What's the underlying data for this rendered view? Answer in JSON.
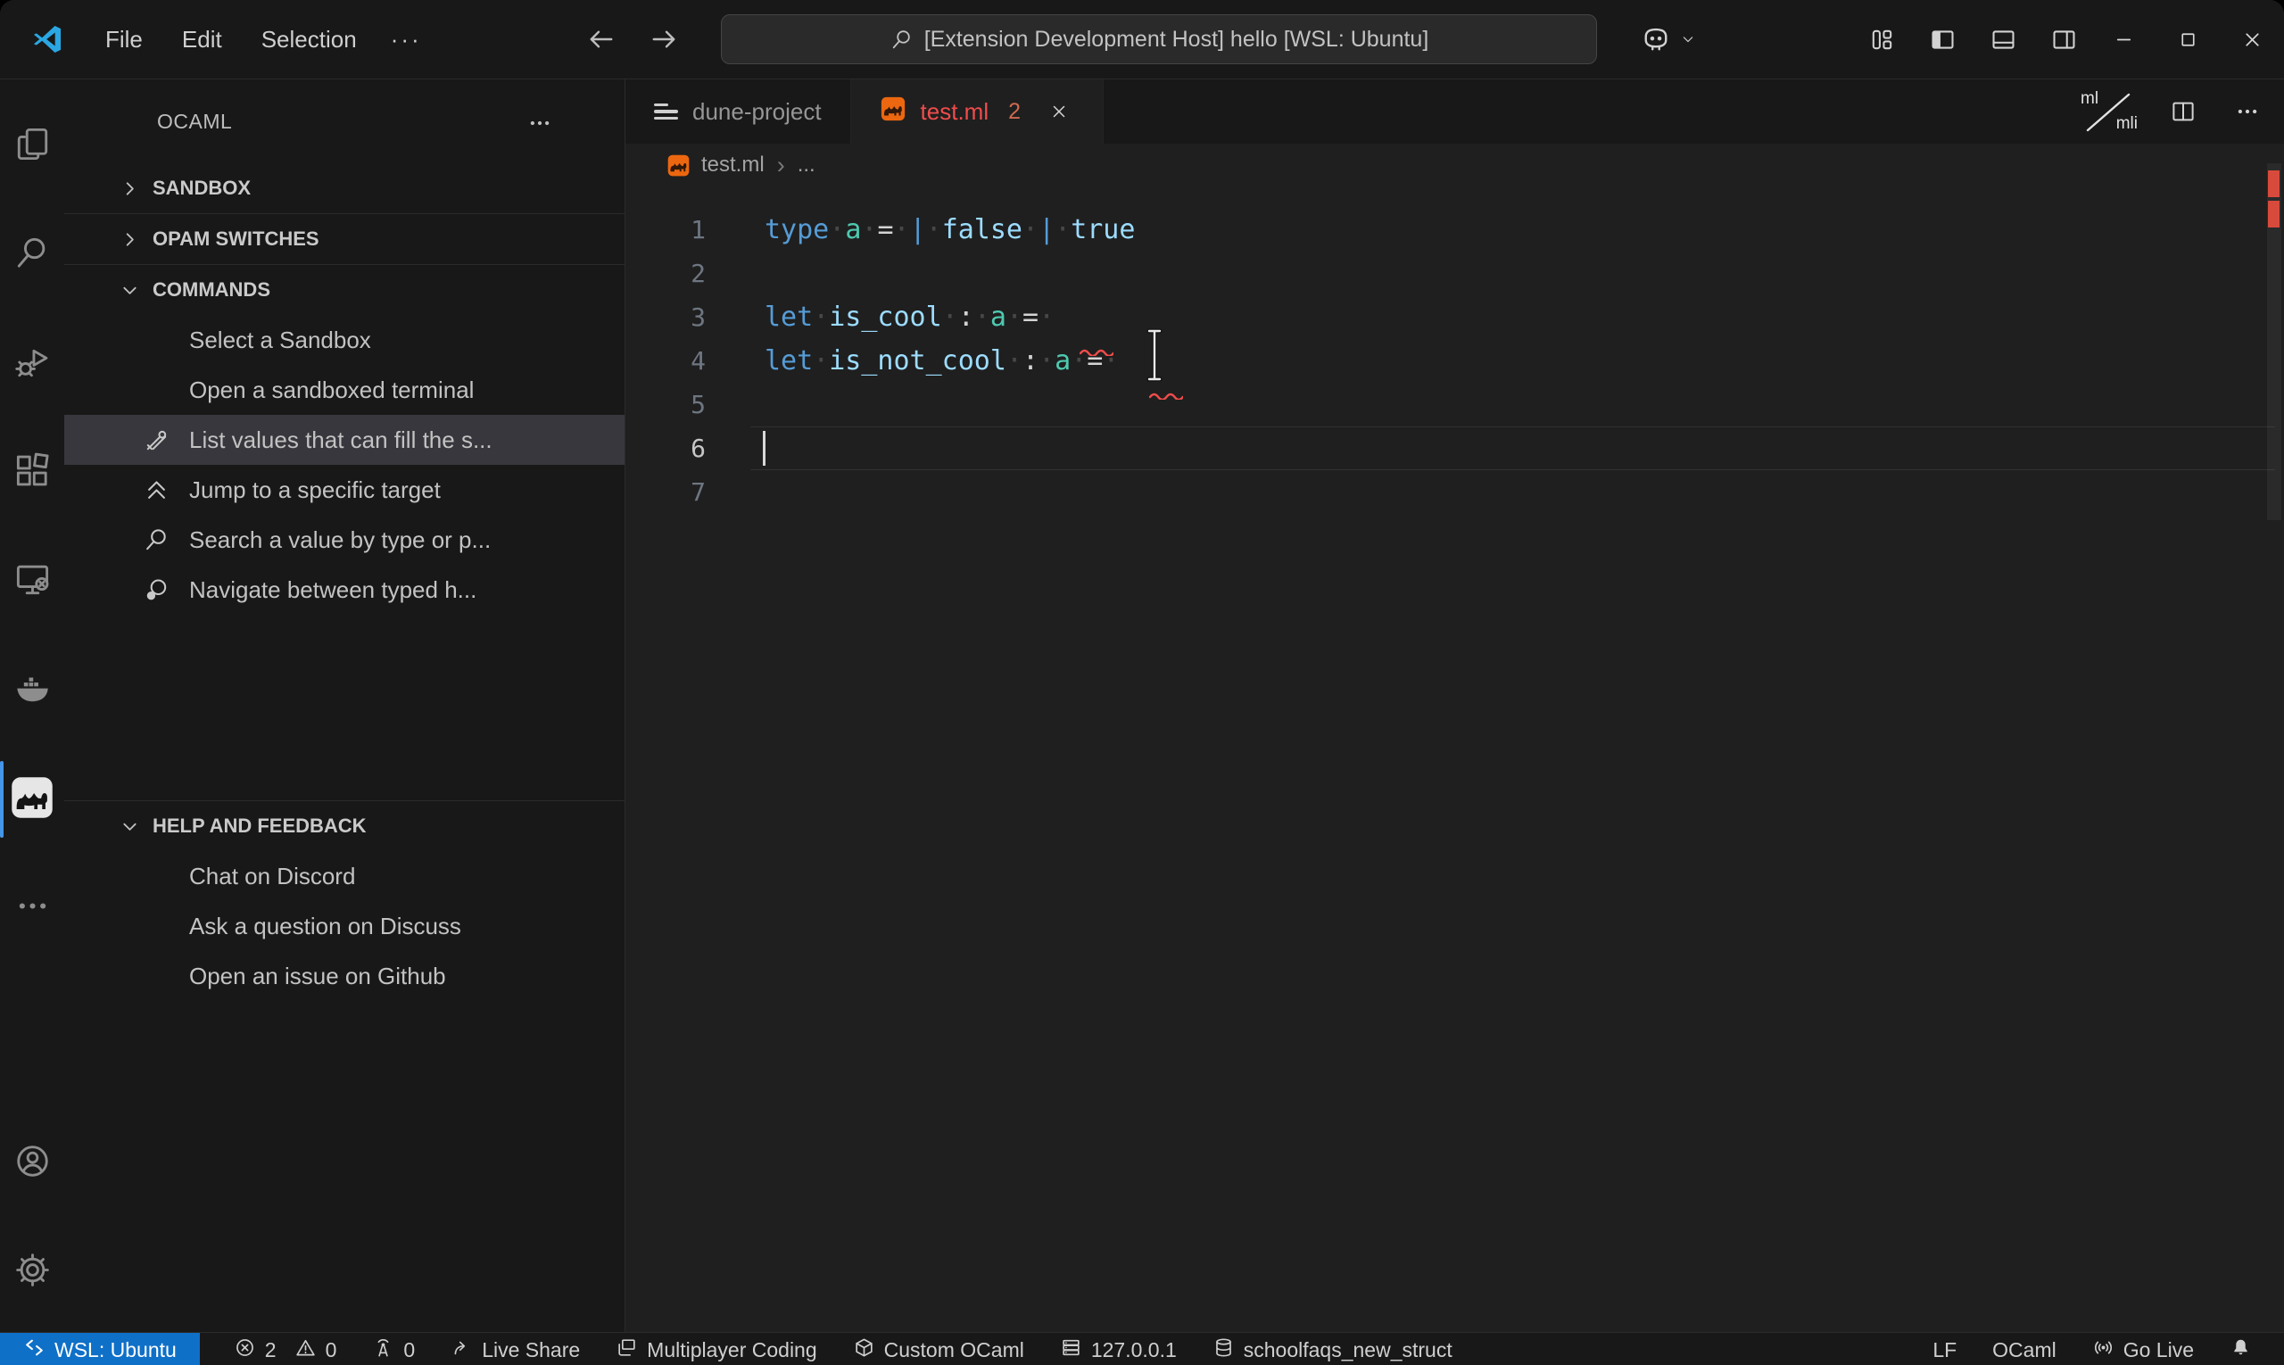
{
  "title_bar": {
    "menus": [
      "File",
      "Edit",
      "Selection"
    ],
    "more_menu": "···",
    "search_text": "[Extension Development Host] hello [WSL: Ubuntu]"
  },
  "activity_bar": {
    "top": [
      {
        "name": "explorer",
        "icon": "explorer"
      },
      {
        "name": "search",
        "icon": "search-big"
      },
      {
        "name": "run-debug",
        "icon": "debug"
      },
      {
        "name": "extensions",
        "icon": "extensions"
      },
      {
        "name": "remote-explorer",
        "icon": "remote-explorer"
      },
      {
        "name": "docker",
        "icon": "docker"
      },
      {
        "name": "ocaml",
        "icon": "ocaml-activity",
        "active": true
      },
      {
        "name": "more",
        "icon": "more"
      }
    ],
    "bottom": [
      {
        "name": "account",
        "icon": "account"
      },
      {
        "name": "settings",
        "icon": "gear"
      }
    ]
  },
  "sidebar": {
    "title": "OCAML",
    "sections": [
      {
        "label": "SANDBOX",
        "collapsed": true,
        "items": []
      },
      {
        "label": "OPAM SWITCHES",
        "collapsed": true,
        "divider": true,
        "items": []
      },
      {
        "label": "COMMANDS",
        "collapsed": false,
        "divider": true,
        "items": [
          {
            "label": "Select a Sandbox"
          },
          {
            "label": "Open a sandboxed terminal"
          },
          {
            "label": "List values that can fill the s...",
            "icon": "tools",
            "selected": true
          },
          {
            "label": "Jump to a specific target",
            "icon": "chevrons-up"
          },
          {
            "label": "Search a value by type or p...",
            "icon": "search-small"
          },
          {
            "label": "Navigate between typed h...",
            "icon": "typed-hole"
          }
        ]
      },
      {
        "label": "HELP AND FEEDBACK",
        "collapsed": false,
        "divider": true,
        "gap_before": 208,
        "items": [
          {
            "label": "Chat on Discord"
          },
          {
            "label": "Ask a question on Discuss"
          },
          {
            "label": "Open an issue on Github"
          }
        ]
      }
    ]
  },
  "editor": {
    "tabs": [
      {
        "label": "dune-project",
        "icon": "dune",
        "active": false
      },
      {
        "label": "test.ml",
        "icon": "ocaml-file",
        "active": true,
        "badge": "2"
      }
    ],
    "actions": {
      "mlmli_top": "ml",
      "mlmli_bottom": "mli"
    },
    "breadcrumb": {
      "file": "test.ml",
      "separator": "›",
      "more": "..."
    },
    "code": {
      "lines": [
        {
          "num": "1",
          "tokens": [
            [
              "type",
              "kw"
            ],
            [
              "·",
              "ws"
            ],
            [
              "a",
              "ty"
            ],
            [
              "·",
              "ws"
            ],
            [
              "=",
              "op"
            ],
            [
              "·",
              "ws"
            ],
            [
              "|",
              "kw"
            ],
            [
              "·",
              "ws"
            ],
            [
              "false",
              "id"
            ],
            [
              "·",
              "ws"
            ],
            [
              "|",
              "kw"
            ],
            [
              "·",
              "ws"
            ],
            [
              "true",
              "id"
            ]
          ]
        },
        {
          "num": "2",
          "tokens": []
        },
        {
          "num": "3",
          "tokens": [
            [
              "let",
              "kw"
            ],
            [
              "·",
              "ws"
            ],
            [
              "is_cool",
              "id"
            ],
            [
              "·",
              "ws"
            ],
            [
              ":",
              "op"
            ],
            [
              "·",
              "ws"
            ],
            [
              "a",
              "ty"
            ],
            [
              "·",
              "ws"
            ],
            [
              "=",
              "op"
            ],
            [
              "·",
              "ws"
            ]
          ],
          "squiggle_col": 19.6
        },
        {
          "num": "4",
          "tokens": [
            [
              "let",
              "kw"
            ],
            [
              "·",
              "ws"
            ],
            [
              "is_not_cool",
              "id"
            ],
            [
              "·",
              "ws"
            ],
            [
              ":",
              "op"
            ],
            [
              "·",
              "ws"
            ],
            [
              "a",
              "ty"
            ],
            [
              "·",
              "ws"
            ],
            [
              "=",
              "op"
            ],
            [
              "·",
              "ws"
            ]
          ],
          "squiggle_col": 23.9,
          "ibeam_col": 23.7
        },
        {
          "num": "5",
          "tokens": []
        },
        {
          "num": "6",
          "tokens": [],
          "active": true
        },
        {
          "num": "7",
          "tokens": []
        }
      ]
    }
  },
  "status_bar": {
    "left": [
      {
        "name": "remote",
        "icon": "remote",
        "label": "WSL: Ubuntu",
        "accent": true
      },
      {
        "name": "problems",
        "icon": "error-circle",
        "label": "2",
        "icon2": "warning-triangle",
        "label2": "0"
      },
      {
        "name": "ports",
        "icon": "broadcast-tower",
        "label": "0"
      },
      {
        "name": "live-share",
        "icon": "live-share",
        "label": "Live Share"
      },
      {
        "name": "multiplayer-coding",
        "icon": "windows-multi",
        "label": "Multiplayer Coding"
      },
      {
        "name": "custom-ocaml",
        "icon": "package-box",
        "label": "Custom OCaml"
      },
      {
        "name": "server",
        "icon": "server-stack",
        "label": "127.0.0.1"
      },
      {
        "name": "database",
        "icon": "database",
        "label": "schoolfaqs_new_struct"
      }
    ],
    "right": [
      {
        "name": "eol",
        "label": "LF"
      },
      {
        "name": "language-mode",
        "label": "OCaml"
      },
      {
        "name": "go-live",
        "icon": "go-live",
        "label": "Go Live"
      },
      {
        "name": "notifications",
        "icon": "bell"
      }
    ]
  },
  "colors": {
    "accent_blue": "#0f70c8",
    "activity_active_blue": "#4595e8",
    "error_red": "#f14c4c",
    "ocaml_orange": "#ec670f",
    "keyword_blue": "#569cd6",
    "type_teal": "#4ec9b0",
    "ident_blue": "#9cdcfe",
    "chrome_bg": "#181818",
    "editor_bg": "#1f1f1f"
  }
}
